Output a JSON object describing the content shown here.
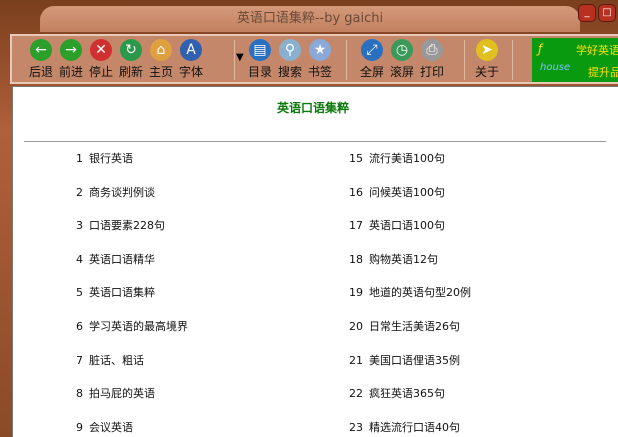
{
  "window": {
    "title": "英语口语集粹--by gaichi",
    "minimize": "_",
    "maximize": "□"
  },
  "toolbar": {
    "buttons": [
      {
        "label": "后退",
        "icon": "back-arrow-icon",
        "color": "#2aa02a",
        "glyph": "←"
      },
      {
        "label": "前进",
        "icon": "forward-arrow-icon",
        "color": "#2aa02a",
        "glyph": "→"
      },
      {
        "label": "停止",
        "icon": "stop-icon",
        "color": "#d03030",
        "glyph": "✕"
      },
      {
        "label": "刷新",
        "icon": "refresh-icon",
        "color": "#2a9a4a",
        "glyph": "↻"
      },
      {
        "label": "主页",
        "icon": "home-icon",
        "color": "#e0a040",
        "glyph": "⌂"
      },
      {
        "label": "字体",
        "icon": "font-icon",
        "color": "#3060b0",
        "glyph": "A"
      },
      {
        "label": "目录",
        "icon": "contents-icon",
        "color": "#2a70c0",
        "glyph": "▤"
      },
      {
        "label": "搜索",
        "icon": "search-icon",
        "color": "#8ab0d0",
        "glyph": "⚲"
      },
      {
        "label": "书签",
        "icon": "bookmark-star-icon",
        "color": "#8aa8d8",
        "glyph": "★"
      },
      {
        "label": "全屏",
        "icon": "fullscreen-icon",
        "color": "#2a70c0",
        "glyph": "⤢"
      },
      {
        "label": "滚屏",
        "icon": "scroll-clock-icon",
        "color": "#3a9a5a",
        "glyph": "◷"
      },
      {
        "label": "打印",
        "icon": "print-icon",
        "color": "#999999",
        "glyph": "⎙"
      },
      {
        "label": "关于",
        "icon": "pointer-icon",
        "color": "#e0c020",
        "glyph": "➤"
      }
    ],
    "banner_text1": "学好英语",
    "banner_text2": "提升品",
    "banner_logo": "house"
  },
  "content": {
    "title": "英语口语集粹",
    "left": [
      {
        "n": "1",
        "t": "银行英语"
      },
      {
        "n": "2",
        "t": "商务谈判例谈"
      },
      {
        "n": "3",
        "t": "口语要素228句"
      },
      {
        "n": "4",
        "t": "英语口语精华"
      },
      {
        "n": "5",
        "t": "英语口语集粹"
      },
      {
        "n": "6",
        "t": "学习英语的最高境界"
      },
      {
        "n": "7",
        "t": "脏话、粗话"
      },
      {
        "n": "8",
        "t": "拍马屁的英语"
      },
      {
        "n": "9",
        "t": "会议英语"
      }
    ],
    "right": [
      {
        "n": "15",
        "t": "流行美语100句"
      },
      {
        "n": "16",
        "t": "问候英语100句"
      },
      {
        "n": "17",
        "t": "英语口语100句"
      },
      {
        "n": "18",
        "t": "购物英语12句"
      },
      {
        "n": "19",
        "t": "地道的英语句型20例"
      },
      {
        "n": "20",
        "t": "日常生活美语26句"
      },
      {
        "n": "21",
        "t": "美国口语俚语35例"
      },
      {
        "n": "22",
        "t": "疯狂英语365句"
      },
      {
        "n": "23",
        "t": "精选流行口语40句"
      }
    ]
  }
}
